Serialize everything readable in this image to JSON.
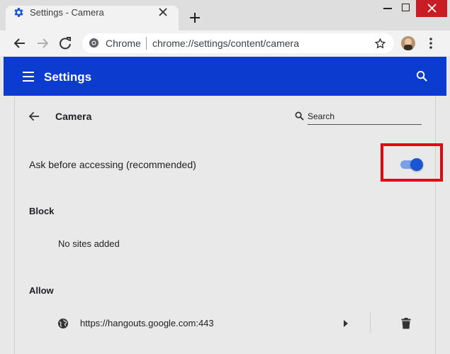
{
  "browser": {
    "tab_title": "Settings - Camera",
    "omnibox_site_label": "Chrome",
    "url": "chrome://settings/content/camera"
  },
  "header": {
    "title": "Settings"
  },
  "page": {
    "title": "Camera",
    "search_label": "Search",
    "ask_label": "Ask before accessing (recommended)",
    "ask_enabled": true,
    "block_heading": "Block",
    "block_empty": "No sites added",
    "allow_heading": "Allow",
    "allow_sites": [
      {
        "url": "https://hangouts.google.com:443"
      }
    ]
  },
  "colors": {
    "header_blue": "#0b3ccf",
    "toggle_on": "#1a55d6",
    "highlight_red": "#e30613"
  },
  "icons": [
    "settings-gear-icon",
    "close-icon",
    "plus-icon",
    "back-icon",
    "forward-icon",
    "reload-icon",
    "chrome-icon",
    "star-icon",
    "more-vert-icon",
    "menu-icon",
    "search-icon",
    "arrow-back-icon",
    "globe-icon",
    "chevron-right-icon",
    "trash-icon"
  ]
}
